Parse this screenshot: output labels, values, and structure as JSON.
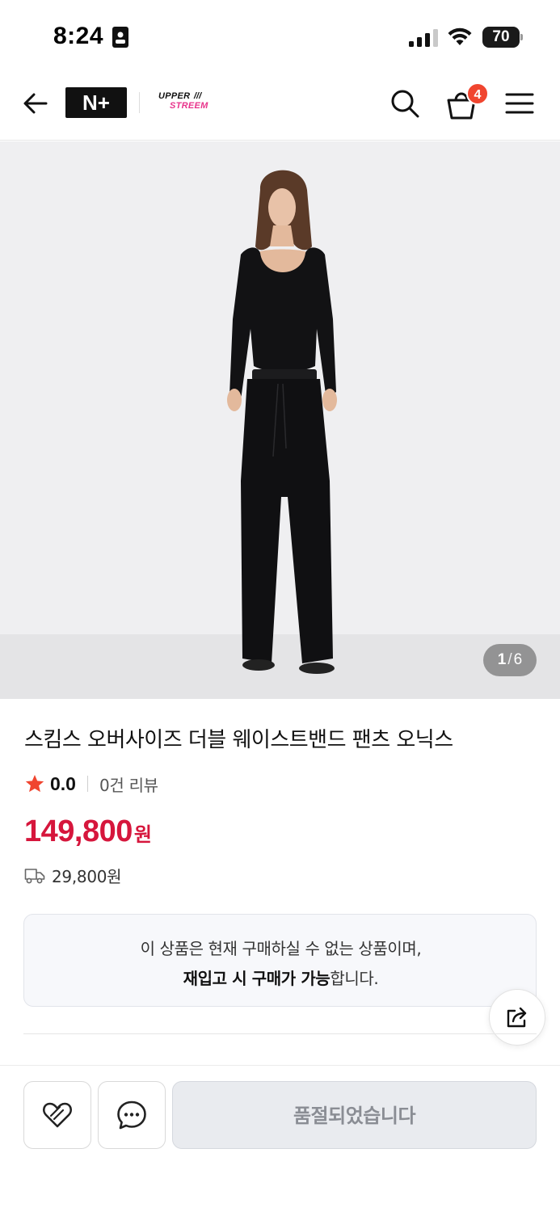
{
  "status_bar": {
    "time": "8:24",
    "battery": "70"
  },
  "nav": {
    "logo_text": "N+",
    "brand_upper": "UPPER",
    "brand_lower": "STREEM",
    "cart_count": "4"
  },
  "gallery": {
    "current": "1",
    "total": "6",
    "separator": "/"
  },
  "product": {
    "title": "스킴스 오버사이즈 더블 웨이스트밴드 팬츠 오닉스",
    "rating": "0.0",
    "review_count": "0건 리뷰",
    "price": "149,800",
    "price_unit": "원",
    "shipping_fee": "29,800원"
  },
  "notice": {
    "line1": "이 상품은 현재 구매하실 수 없는 상품이며,",
    "line2_bold": "재입고 시 구매가 가능",
    "line2_rest": "합니다."
  },
  "bottom_bar": {
    "soldout_label": "품절되었습니다"
  },
  "colors": {
    "price": "#d6163c",
    "badge": "#f0452f",
    "star": "#f0452f",
    "brand_pink": "#e8338b"
  },
  "icons": [
    "back-arrow-icon",
    "search-icon",
    "cart-icon",
    "menu-icon",
    "star-icon",
    "truck-icon",
    "share-icon",
    "heart-icon",
    "chat-icon"
  ]
}
